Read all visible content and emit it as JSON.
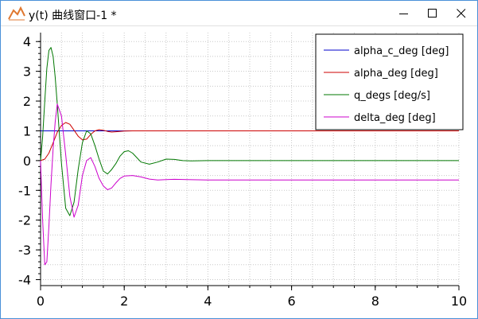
{
  "window": {
    "title": "y(t) 曲线窗口-1 *",
    "controls": [
      "minimize",
      "maximize",
      "close"
    ],
    "icon": "chart-line-icon"
  },
  "chart_data": {
    "type": "line",
    "title": "",
    "xlabel": "",
    "ylabel": "",
    "xlim": [
      0,
      10
    ],
    "ylim": [
      -4.2,
      4.3
    ],
    "xticks": [
      0,
      2,
      4,
      6,
      8,
      10
    ],
    "yticks": [
      -4,
      -3,
      -2,
      -1,
      0,
      1,
      2,
      3,
      4
    ],
    "grid": true,
    "legend_position": "top-right",
    "series": [
      {
        "name": "alpha_c_deg [deg]",
        "color": "#0000cc",
        "x": [
          0,
          10
        ],
        "y": [
          1,
          1
        ]
      },
      {
        "name": "alpha_deg [deg]",
        "color": "#cc0000",
        "x": [
          0,
          0.1,
          0.2,
          0.3,
          0.4,
          0.5,
          0.6,
          0.7,
          0.8,
          0.9,
          1.0,
          1.1,
          1.2,
          1.3,
          1.4,
          1.5,
          1.6,
          1.7,
          1.8,
          2.0,
          2.2,
          2.5,
          3.0,
          10
        ],
        "y": [
          0,
          0.05,
          0.25,
          0.6,
          0.95,
          1.18,
          1.28,
          1.22,
          1.02,
          0.82,
          0.7,
          0.72,
          0.88,
          1.0,
          1.04,
          1.02,
          0.98,
          0.96,
          0.97,
          0.99,
          1.0,
          1.0,
          1.0,
          1.0
        ]
      },
      {
        "name": "q_degs [deg/s]",
        "color": "#007700",
        "x": [
          0,
          0.05,
          0.1,
          0.15,
          0.2,
          0.25,
          0.3,
          0.35,
          0.4,
          0.5,
          0.6,
          0.7,
          0.8,
          0.9,
          1.0,
          1.1,
          1.2,
          1.3,
          1.4,
          1.5,
          1.6,
          1.7,
          1.8,
          1.9,
          2.0,
          2.1,
          2.2,
          2.3,
          2.4,
          2.6,
          2.8,
          3.0,
          3.2,
          3.4,
          3.6,
          4.0,
          10
        ],
        "y": [
          0,
          0.8,
          2.0,
          3.1,
          3.7,
          3.8,
          3.5,
          2.8,
          1.9,
          -0.1,
          -1.6,
          -1.85,
          -1.4,
          -0.3,
          0.6,
          1.0,
          0.9,
          0.5,
          0.05,
          -0.35,
          -0.45,
          -0.3,
          -0.1,
          0.15,
          0.3,
          0.33,
          0.25,
          0.1,
          -0.05,
          -0.12,
          -0.05,
          0.05,
          0.04,
          0.0,
          -0.01,
          0.0,
          0.0
        ]
      },
      {
        "name": "delta_deg [deg]",
        "color": "#cc00cc",
        "x": [
          0,
          0.05,
          0.1,
          0.15,
          0.2,
          0.25,
          0.3,
          0.35,
          0.4,
          0.5,
          0.6,
          0.7,
          0.8,
          0.9,
          1.0,
          1.1,
          1.2,
          1.3,
          1.4,
          1.5,
          1.6,
          1.7,
          1.8,
          1.9,
          2.0,
          2.2,
          2.4,
          2.6,
          2.8,
          3.0,
          3.2,
          3.5,
          4.0,
          10
        ],
        "y": [
          0,
          -2.0,
          -3.5,
          -3.4,
          -2.2,
          -0.8,
          0.4,
          1.3,
          1.9,
          1.5,
          0.2,
          -1.2,
          -1.9,
          -1.5,
          -0.5,
          0.0,
          0.1,
          -0.2,
          -0.6,
          -0.85,
          -0.98,
          -0.92,
          -0.75,
          -0.6,
          -0.52,
          -0.5,
          -0.55,
          -0.62,
          -0.65,
          -0.64,
          -0.63,
          -0.64,
          -0.65,
          -0.65
        ]
      }
    ]
  }
}
